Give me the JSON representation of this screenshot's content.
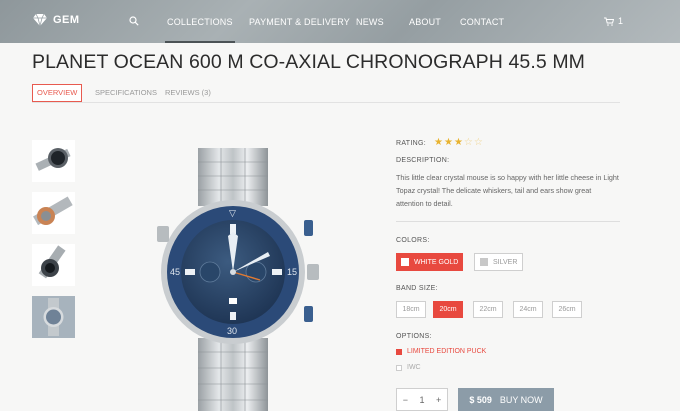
{
  "header": {
    "logo_text": "GEM",
    "nav": [
      "COLLECTIONS",
      "PAYMENT & DELIVERY",
      "NEWS",
      "ABOUT",
      "CONTACT"
    ],
    "cart_count": "1"
  },
  "product": {
    "title": "PLANET OCEAN 600 M CO-AXIAL CHRONOGRAPH 45.5 MM",
    "tabs": [
      "OVERVIEW",
      "SPECIFICATIONS",
      "REVIEWS (3)"
    ],
    "rating_label": "RATING:",
    "rating": 3,
    "rating_max": 5,
    "description_label": "DESCRIPTION:",
    "description": "This little clear crystal mouse is so happy with her little cheese in Light Topaz crystal! The delicate whiskers, tail and ears show great attention to detail.",
    "colors_label": "COLORS:",
    "colors": [
      {
        "label": "WHITE GOLD",
        "selected": true,
        "swatch": "#ffffff"
      },
      {
        "label": "SILVER",
        "selected": false,
        "swatch": "#c8c8c8"
      }
    ],
    "band_label": "BAND SIZE:",
    "band_sizes": [
      {
        "label": "18cm",
        "selected": false
      },
      {
        "label": "20cm",
        "selected": true
      },
      {
        "label": "22cm",
        "selected": false
      },
      {
        "label": "24cm",
        "selected": false
      },
      {
        "label": "26cm",
        "selected": false
      }
    ],
    "options_label": "OPTIONS:",
    "options": [
      {
        "label": "LIMITED EDITION PUCK",
        "selected": true
      },
      {
        "label": "IWC",
        "selected": false
      }
    ],
    "quantity": {
      "minus": "−",
      "value": "1",
      "plus": "+"
    },
    "price": "$ 509",
    "buy_label": "BUY NOW"
  },
  "colors": {
    "accent": "#e8493f",
    "buy_button": "#8c9ca8",
    "star": "#e8b330",
    "bezel": "#2b4a78"
  },
  "icons": [
    "diamond-logo-icon",
    "search-icon",
    "cart-icon",
    "star-icon"
  ]
}
